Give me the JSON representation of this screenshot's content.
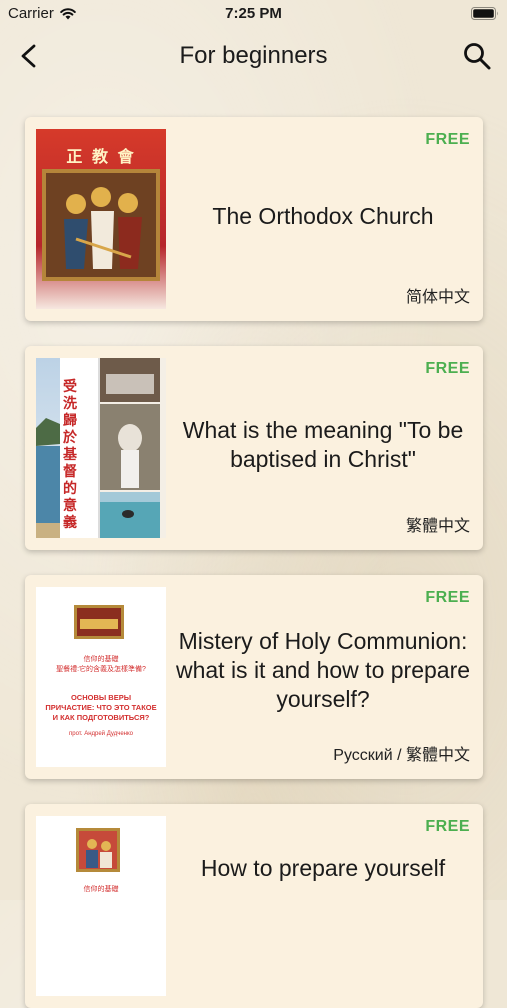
{
  "status_bar": {
    "carrier": "Carrier",
    "time": "7:25 PM"
  },
  "nav": {
    "title": "For beginners",
    "back_icon": "chevron-left-icon",
    "search_icon": "search-icon"
  },
  "items": [
    {
      "title": "The Orthodox Church",
      "badge": "FREE",
      "language": "简体中文",
      "cover_text": "正 教 會"
    },
    {
      "title": "What is the meaning \"To be baptised in Christ\"",
      "badge": "FREE",
      "language": "繁體中文",
      "cover_text": "受洗歸於基督的意義"
    },
    {
      "title": "Mistery of Holy Communion: what is it and how to prepare yourself?",
      "badge": "FREE",
      "language": "Русский / 繁體中文",
      "cover_text": {
        "zh1": "信仰的基礎",
        "zh2": "聖餐禮:它的含義及怎樣準備?",
        "ru1": "ОСНОВЫ ВЕРЫ",
        "ru2": "ПРИЧАСТИЕ: ЧТО ЭТО ТАКОЕ",
        "ru3": "И КАК ПОДГОТОВИТЬСЯ?",
        "author": "прот. Андрей Дудченко"
      }
    },
    {
      "title": "How to prepare yourself",
      "badge": "FREE",
      "language": "",
      "cover_text": "信仰的基礎"
    }
  ],
  "colors": {
    "accent_free": "#4caf50",
    "card_bg": "#fbf1df",
    "page_bg": "#efe7d6"
  }
}
